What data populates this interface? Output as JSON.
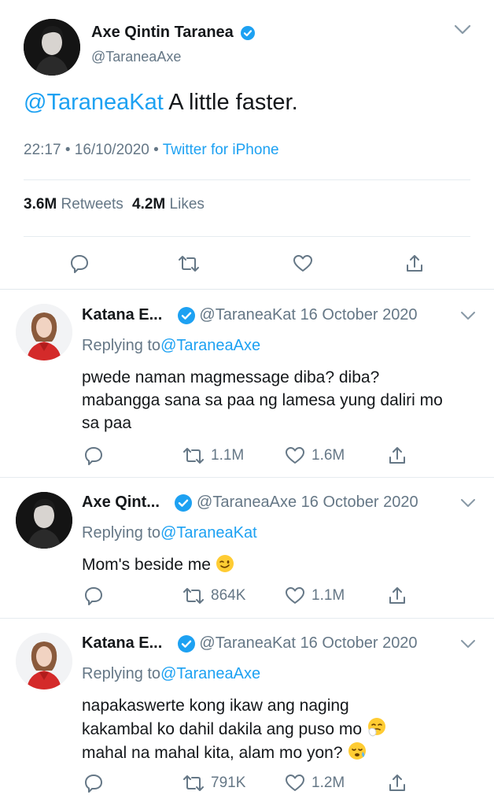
{
  "main_tweet": {
    "display_name": "Axe Qintin Taranea",
    "handle": "@TaraneaAxe",
    "mention": "@TaraneaKat",
    "text": " A little faster.",
    "time": "22:17",
    "date": "16/10/2020",
    "source": "Twitter for iPhone",
    "retweets_count": "3.6M",
    "retweets_label": "Retweets",
    "likes_count": "4.2M",
    "likes_label": "Likes"
  },
  "replies": [
    {
      "display_name": "Katana E...",
      "handle": "@TaraneaKat",
      "date": "16 October 2020",
      "replying_label": "Replying to",
      "replying_to": "@TaraneaAxe",
      "text": "pwede naman magmessage diba? diba? mabangga sana sa paa ng lamesa yung daliri mo sa paa",
      "retweets": "1.1M",
      "likes": "1.6M"
    },
    {
      "display_name": "Axe Qint...",
      "handle": "@TaraneaAxe",
      "date": "16 October 2020",
      "replying_label": "Replying to",
      "replying_to": "@TaraneaKat",
      "text": "Mom's beside me",
      "retweets": "864K",
      "likes": "1.1M"
    },
    {
      "display_name": "Katana E...",
      "handle": "@TaraneaKat",
      "date": "16 October 2020",
      "replying_label": "Replying to",
      "replying_to": "@TaraneaAxe",
      "text_line1": "napakaswerte kong ikaw ang naging",
      "text_line2": "kakambal ko dahil dakila ang puso mo",
      "text_line3": "mahal na mahal kita, alam mo yon?",
      "retweets": "791K",
      "likes": "1.2M"
    }
  ],
  "icons": {
    "verified": "verified-badge-icon",
    "chevron": "chevron-down-icon",
    "reply": "reply-icon",
    "retweet": "retweet-icon",
    "like": "heart-icon",
    "share": "share-icon",
    "wink": "winking-face-emoji",
    "sneeze": "sneezing-face-emoji",
    "sleepy": "sleepy-face-emoji"
  },
  "colors": {
    "link": "#1da1f2",
    "muted": "#657786",
    "text": "#14171a",
    "divider": "#e6ecf0"
  }
}
